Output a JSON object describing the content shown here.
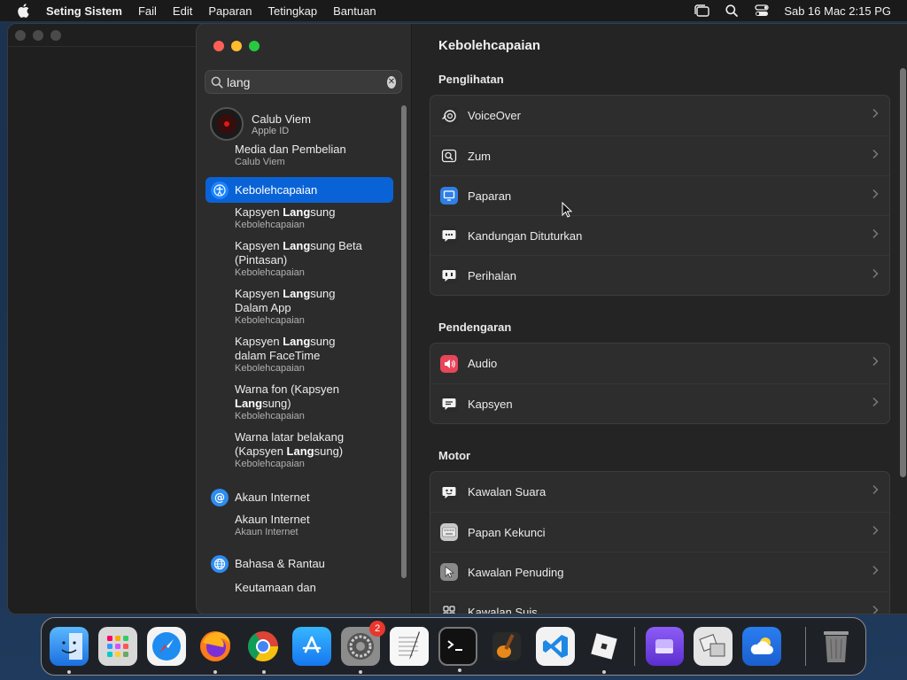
{
  "menubar": {
    "app_name": "Seting Sistem",
    "items": [
      "Fail",
      "Edit",
      "Paparan",
      "Tetingkap",
      "Bantuan"
    ],
    "clock": "Sab 16 Mac  2:15 PG"
  },
  "search": {
    "value": "lang"
  },
  "sidebar": {
    "profile": {
      "name": "Calub Viem",
      "sub": "Apple ID"
    },
    "media": {
      "title": "Media dan Pembelian",
      "sub": "Calub Viem"
    },
    "accessibility": {
      "label": "Kebolehcapaian"
    },
    "results": [
      {
        "pre": "Kapsyen ",
        "match": "Lang",
        "post": "sung",
        "line2": "",
        "sub": "Kebolehcapaian"
      },
      {
        "pre": "Kapsyen ",
        "match": "Lang",
        "post": "sung Beta",
        "line2": "(Pintasan)",
        "sub": "Kebolehcapaian"
      },
      {
        "pre": "Kapsyen ",
        "match": "Lang",
        "post": "sung",
        "line2": "Dalam App",
        "sub": "Kebolehcapaian"
      },
      {
        "pre": "Kapsyen ",
        "match": "Lang",
        "post": "sung",
        "line2": "dalam FaceTime",
        "sub": "Kebolehcapaian"
      },
      {
        "pre": "Warna fon (Kapsyen",
        "match": "",
        "post": "",
        "line2_match": "Lang",
        "line2_post": "sung)",
        "sub": "Kebolehcapaian"
      },
      {
        "pre": "Warna latar belakang",
        "match": "",
        "post": "",
        "line2_pre": "(Kapsyen ",
        "line2_match": "Lang",
        "line2_post": "sung)",
        "sub": "Kebolehcapaian"
      }
    ],
    "internet": {
      "label": "Akaun Internet",
      "sub_title": "Akaun Internet",
      "sub_sub": "Akaun Internet"
    },
    "language": {
      "label": "Bahasa & Rantau",
      "sub_title": "Keutamaan dan"
    }
  },
  "main": {
    "title": "Kebolehcapaian",
    "sections": [
      {
        "heading": "Penglihatan",
        "rows": [
          "VoiceOver",
          "Zum",
          "Paparan",
          "Kandungan Dituturkan",
          "Perihalan"
        ]
      },
      {
        "heading": "Pendengaran",
        "rows": [
          "Audio",
          "Kapsyen"
        ]
      },
      {
        "heading": "Motor",
        "rows": [
          "Kawalan Suara",
          "Papan Kekunci",
          "Kawalan Penuding",
          "Kawalan Suis"
        ]
      }
    ]
  },
  "dock": {
    "settings_badge": "2"
  },
  "colors": {
    "accent": "#0a63d6",
    "window_bg": "#262626",
    "sidebar_bg": "#2c2c2c"
  }
}
